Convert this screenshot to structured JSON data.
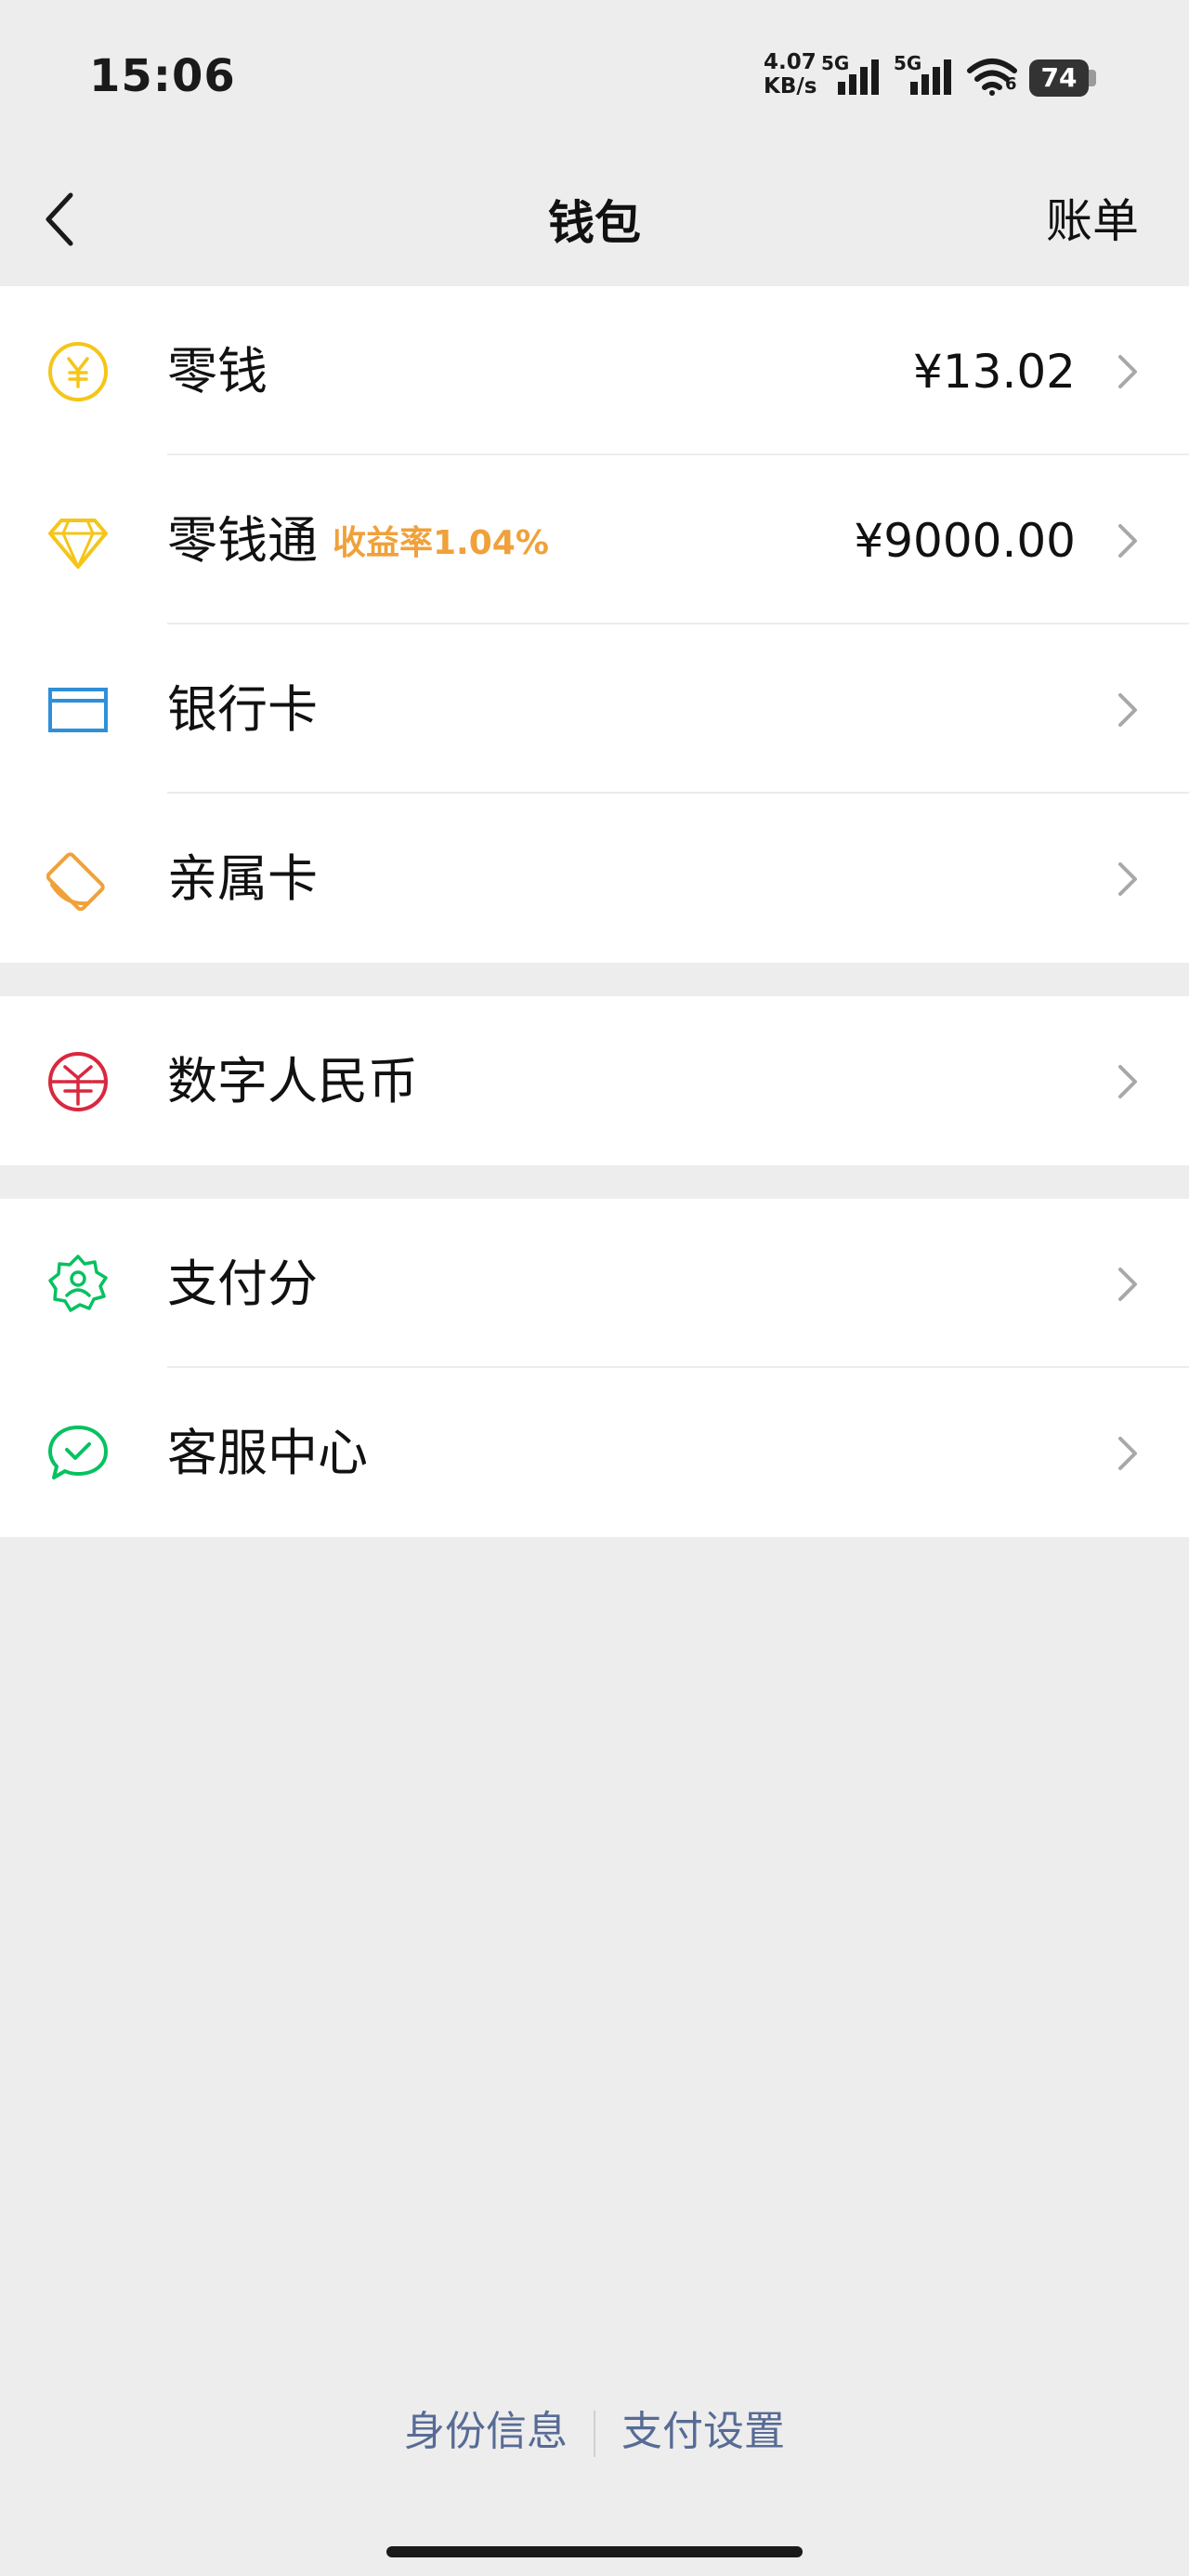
{
  "status_bar": {
    "time": "15:06",
    "net_speed_value": "4.07",
    "net_speed_unit": "KB/s",
    "sim1_label": "5G",
    "sim2_label": "5G",
    "wifi_label": "6",
    "battery": "74"
  },
  "nav": {
    "title": "钱包",
    "right": "账单",
    "back_icon": "chevron-left-icon"
  },
  "group1": [
    {
      "label": "零钱",
      "value": "¥13.02",
      "icon": "yuan-coin-icon",
      "color": "#f5c518"
    },
    {
      "label": "零钱通",
      "badge": "收益率1.04%",
      "value": "¥9000.00",
      "icon": "diamond-icon",
      "color": "#f5c518"
    },
    {
      "label": "银行卡",
      "icon": "bank-card-icon",
      "color": "#2f8fd8"
    },
    {
      "label": "亲属卡",
      "icon": "family-card-icon",
      "color": "#f0a13a"
    }
  ],
  "group2": [
    {
      "label": "数字人民币",
      "icon": "digital-rmb-icon",
      "color": "#d9283f"
    }
  ],
  "group3": [
    {
      "label": "支付分",
      "icon": "pay-score-icon",
      "color": "#07c160"
    },
    {
      "label": "客服中心",
      "icon": "customer-service-icon",
      "color": "#07c160"
    }
  ],
  "footer": {
    "identity": "身份信息",
    "settings": "支付设置"
  },
  "colors": {
    "background": "#ededed",
    "link": "#576b95",
    "badge": "#f0a13a"
  }
}
